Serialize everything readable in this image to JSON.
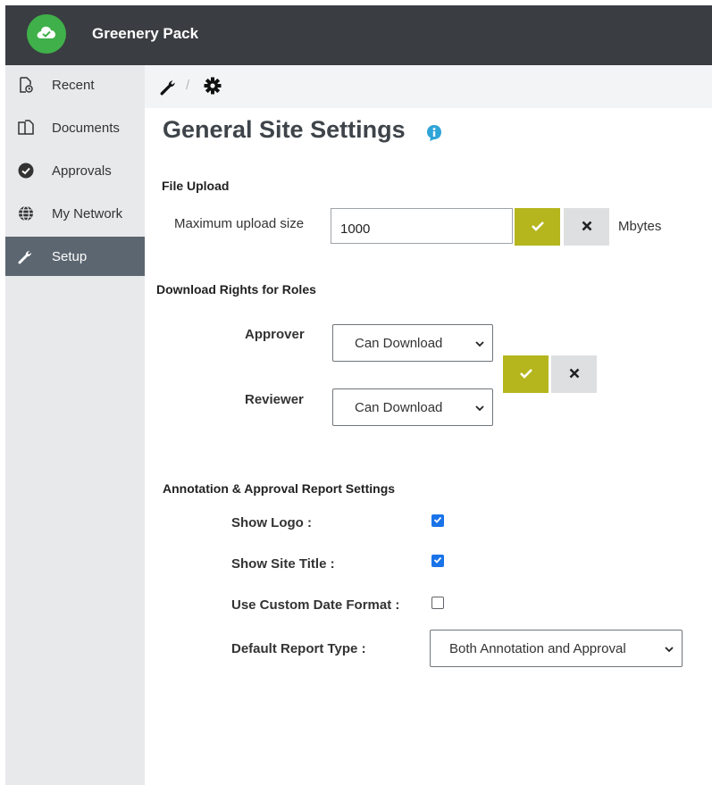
{
  "app": {
    "title": "Greenery Pack",
    "logo_icon": "cloud-check-icon",
    "brand_color": "#3fb04a"
  },
  "sidebar": {
    "items": [
      {
        "label": "Recent",
        "icon": "recent-document-icon"
      },
      {
        "label": "Documents",
        "icon": "documents-icon"
      },
      {
        "label": "Approvals",
        "icon": "check-circle-icon"
      },
      {
        "label": "My Network",
        "icon": "globe-icon"
      },
      {
        "label": "Setup",
        "icon": "wrench-icon",
        "active": true
      }
    ]
  },
  "breadcrumb": {
    "items": [
      "wrench-icon",
      "gear-icon"
    ],
    "separator": "/"
  },
  "page": {
    "title": "General Site Settings",
    "title_icon": "info-icon"
  },
  "file_upload": {
    "section_title": "File Upload",
    "max_label": "Maximum upload size",
    "max_value": "1000",
    "unit": "Mbytes"
  },
  "download_rights": {
    "section_title": "Download Rights for Roles",
    "approver_label": "Approver",
    "approver_value": "Can Download",
    "reviewer_label": "Reviewer",
    "reviewer_value": "Can Download"
  },
  "report_settings": {
    "section_title": "Annotation & Approval Report Settings",
    "show_logo_label": "Show Logo :",
    "show_logo": true,
    "show_site_title_label": "Show Site Title :",
    "show_site_title": true,
    "custom_date_label": "Use Custom Date Format :",
    "custom_date": false,
    "report_type_label": "Default Report Type :",
    "report_type_value": "Both Annotation and Approval"
  },
  "colors": {
    "confirm": "#b5b51e",
    "cancel": "#dddfe1",
    "checkbox": "#1a73e8",
    "topbar": "#3a3d42",
    "sidebar_active": "#5b6670"
  }
}
